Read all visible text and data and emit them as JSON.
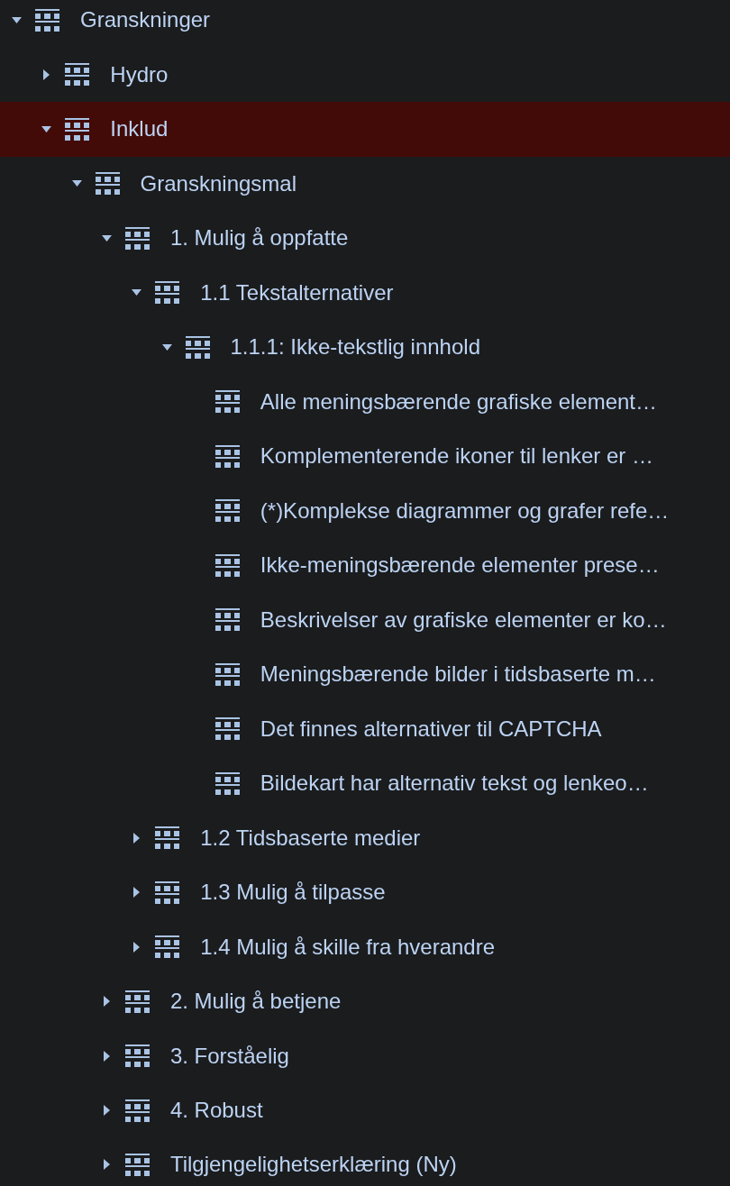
{
  "tree": [
    {
      "label": "Granskninger",
      "expanded": true,
      "selected": false,
      "children": [
        {
          "label": "Hydro",
          "expanded": false,
          "selected": false
        },
        {
          "label": "Inklud",
          "expanded": true,
          "selected": true,
          "children": [
            {
              "label": "Granskningsmal",
              "expanded": true,
              "selected": false,
              "children": [
                {
                  "label": "1. Mulig å oppfatte",
                  "expanded": true,
                  "selected": false,
                  "children": [
                    {
                      "label": "1.1 Tekstalternativer",
                      "expanded": true,
                      "selected": false,
                      "children": [
                        {
                          "label": "1.1.1: Ikke-tekstlig innhold",
                          "expanded": true,
                          "selected": false,
                          "children": [
                            {
                              "label": "Alle meningsbærende grafiske element…",
                              "selected": false
                            },
                            {
                              "label": "Komplementerende ikoner til lenker er …",
                              "selected": false
                            },
                            {
                              "label": "(*)Komplekse diagrammer og grafer refe…",
                              "selected": false
                            },
                            {
                              "label": "Ikke-meningsbærende elementer prese…",
                              "selected": false
                            },
                            {
                              "label": "Beskrivelser av grafiske elementer er ko…",
                              "selected": false
                            },
                            {
                              "label": "Meningsbærende bilder i tidsbaserte m…",
                              "selected": false
                            },
                            {
                              "label": "Det finnes alternativer til CAPTCHA",
                              "selected": false
                            },
                            {
                              "label": "Bildekart har alternativ tekst og lenkeo…",
                              "selected": false
                            }
                          ]
                        }
                      ]
                    },
                    {
                      "label": "1.2 Tidsbaserte medier",
                      "expanded": false,
                      "selected": false
                    },
                    {
                      "label": "1.3 Mulig å tilpasse",
                      "expanded": false,
                      "selected": false
                    },
                    {
                      "label": "1.4 Mulig å skille fra hverandre",
                      "expanded": false,
                      "selected": false
                    }
                  ]
                },
                {
                  "label": "2. Mulig å betjene",
                  "expanded": false,
                  "selected": false
                },
                {
                  "label": "3. Forståelig",
                  "expanded": false,
                  "selected": false
                },
                {
                  "label": "4. Robust",
                  "expanded": false,
                  "selected": false
                },
                {
                  "label": "Tilgjengelighetserklæring (Ny)",
                  "expanded": false,
                  "selected": false
                }
              ]
            }
          ]
        }
      ]
    }
  ]
}
